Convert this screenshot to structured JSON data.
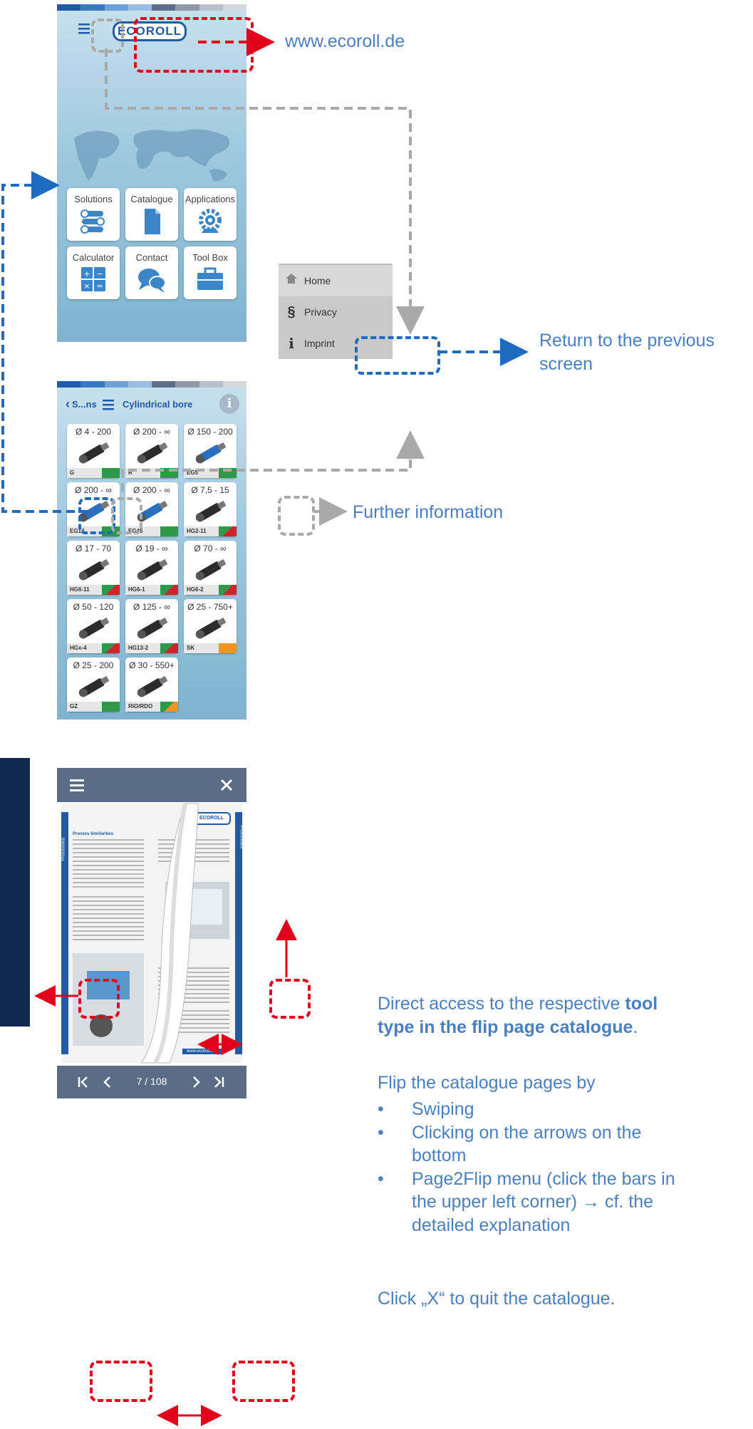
{
  "home_screen": {
    "logo": "ECOROLL",
    "tiles": [
      {
        "label": "Solutions",
        "icon": "solutions-icon"
      },
      {
        "label": "Catalogue",
        "icon": "catalogue-icon"
      },
      {
        "label": "Applications",
        "icon": "applications-icon"
      },
      {
        "label": "Calculator",
        "icon": "calculator-icon"
      },
      {
        "label": "Contact",
        "icon": "contact-icon"
      },
      {
        "label": "Tool Box",
        "icon": "toolbox-icon"
      }
    ]
  },
  "side_menu": {
    "items": [
      {
        "label": "Home",
        "icon": "home-icon"
      },
      {
        "label": "Privacy",
        "icon": "paragraph-icon"
      },
      {
        "label": "Imprint",
        "icon": "info-icon"
      }
    ]
  },
  "solutions_screen": {
    "back_label": "S...ns",
    "title": "Cylindrical bore",
    "products": [
      {
        "range": "Ø 4 - 200",
        "code": "G",
        "status": "#2e9a47"
      },
      {
        "range": "Ø 200 - ∞",
        "code": "R",
        "status": "#2e9a47"
      },
      {
        "range": "Ø 150 - 200",
        "code": "EG5",
        "status": "#2e9a47"
      },
      {
        "range": "Ø 200 - ∞",
        "code": "EG14",
        "status": "#2e9a47"
      },
      {
        "range": "Ø 200 - ∞",
        "code": "EG45",
        "status": "#2e9a47"
      },
      {
        "range": "Ø 7,5 - 15",
        "code": "HG2-11",
        "status": "split"
      },
      {
        "range": "Ø 17 - 70",
        "code": "HG6-11",
        "status": "split"
      },
      {
        "range": "Ø 19 - ∞",
        "code": "HG6-1",
        "status": "split"
      },
      {
        "range": "Ø 70 - ∞",
        "code": "HG6-2",
        "status": "split"
      },
      {
        "range": "Ø 50 - 120",
        "code": "HGx-4",
        "status": "split"
      },
      {
        "range": "Ø 125 - ∞",
        "code": "HG13-2",
        "status": "split"
      },
      {
        "range": "Ø 25 - 750+",
        "code": "SK",
        "status": "#f0961e"
      },
      {
        "range": "Ø 25 - 200",
        "code": "GZ",
        "status": "#2e9a47"
      },
      {
        "range": "Ø 30 - 550+",
        "code": "RIO/RDO",
        "status": "split-orange"
      }
    ]
  },
  "catalogue_screen": {
    "logo": "ECOROLL",
    "side_tab": "Processes",
    "page_indicator": "7 / 108",
    "footer_url": "www.ecoroll.com",
    "heading": "Process Similarities"
  },
  "annotations": {
    "website": "www.ecoroll.de",
    "return_line1": "Return to the previous",
    "return_line2": "screen",
    "further_info": "Further information",
    "direct_access_part1": "Direct access to the respective ",
    "direct_access_bold1": "tool",
    "direct_access_bold2": "type in the flip page catalogue",
    "direct_access_end": ".",
    "flip_intro": "Flip the catalogue pages by",
    "bullets": [
      "Swiping",
      "Clicking on the arrows on the",
      "bottom",
      "Page2Flip menu (click the bars in",
      "the upper left corner) → cf. the",
      "detailed explanation"
    ],
    "quit": "Click „X“ to quit the catalogue."
  },
  "colors": {
    "brand_blue": "#1f5aa6",
    "annotation_blue": "#4a7fc1",
    "red_dash": "#e3001b",
    "blue_dash": "#1f6bbf",
    "gray_dash": "#a9a9a9",
    "green": "#2e9a47",
    "red": "#d2232a",
    "orange": "#f0961e"
  }
}
